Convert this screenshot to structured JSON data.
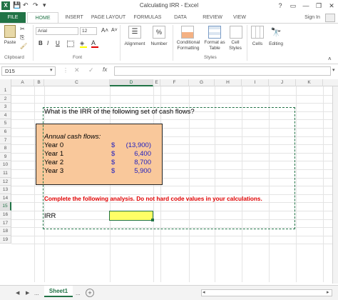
{
  "title_bar": {
    "title": "Calculating IRR - Excel",
    "logo": "X",
    "controls": [
      "?",
      "▭",
      "—",
      "❐",
      "✕"
    ]
  },
  "ribbon_tabs": [
    "FILE",
    "HOME",
    "INSERT",
    "PAGE LAYOUT",
    "FORMULAS",
    "DATA",
    "REVIEW",
    "VIEW"
  ],
  "sign_in": "Sign In",
  "ribbon": {
    "paste": "Paste",
    "clipboard": "Clipboard",
    "font_name": "Arial",
    "font_size": "12",
    "font_group": "Font",
    "alignment": "Alignment",
    "number": "Number",
    "conditional_formatting": [
      "Conditional",
      "Formatting"
    ],
    "format_as_table": [
      "Format as",
      "Table"
    ],
    "cell_styles": [
      "Cell",
      "Styles"
    ],
    "styles_group": "Styles",
    "cells": "Cells",
    "editing": "Editing"
  },
  "formula_bar": {
    "name_box": "D15",
    "fx": "fx",
    "content": ""
  },
  "columns": [
    "A",
    "B",
    "C",
    "D",
    "E",
    "F",
    "G",
    "H",
    "I",
    "J",
    "K"
  ],
  "rows": [
    "1",
    "2",
    "3",
    "4",
    "5",
    "6",
    "7",
    "8",
    "9",
    "10",
    "11",
    "12",
    "13",
    "14",
    "15",
    "16",
    "17",
    "18",
    "19"
  ],
  "cells": {
    "question": "What is the IRR of the following set of cash flows?",
    "table_header": "Annual cash flows:",
    "years": [
      "Year 0",
      "Year 1",
      "Year 2",
      "Year 3"
    ],
    "currency": "$",
    "amounts": [
      "(13,900)",
      "6,400",
      "8,700",
      "5,900"
    ],
    "instruction": "Complete the following analysis. Do not hard code values in your calculations.",
    "irr_label": "IRR"
  },
  "sheet_tabs": {
    "active": "Sheet1",
    "more": "...",
    "add": "+"
  },
  "colors": {
    "excel_green": "#217346",
    "table_fill": "#f9c89b",
    "selected_cell_fill": "#ffff66",
    "amount_blue": "#1f1fbf",
    "instruction_red": "#e00000"
  }
}
